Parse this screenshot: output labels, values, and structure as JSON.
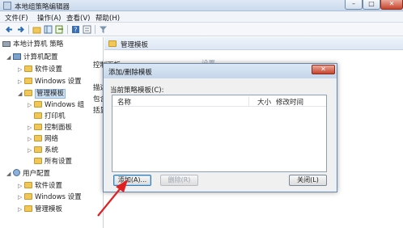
{
  "window": {
    "title": "本地组策略编辑器",
    "min_glyph": "–",
    "max_glyph": "□",
    "close_glyph": "✕"
  },
  "menu": [
    "文件(F)",
    "操作(A)",
    "查看(V)",
    "帮助(H)"
  ],
  "toolbar_icons": [
    "back-arrow-icon",
    "forward-arrow-icon",
    "up-folder-icon",
    "show-hide-tree-icon",
    "export-icon",
    "help-icon",
    "properties-icon",
    "filter-icon"
  ],
  "tree": {
    "root": "本地计算机 策略",
    "computer_config": "计算机配置",
    "c_software": "软件设置",
    "c_windows": "Windows 设置",
    "c_admin": "管理模板",
    "c_admin_windows": "Windows 组",
    "c_printer": "打印机",
    "c_control_panel": "控制面板",
    "c_network": "网络",
    "c_system": "系统",
    "c_all_settings": "所有设置",
    "user_config": "用户配置",
    "u_software": "软件设置",
    "u_windows": "Windows 设置",
    "u_admin": "管理模板",
    "expanded": "◢",
    "collapsed": "▷"
  },
  "right_pane": {
    "header": "管理模板",
    "heading": "控制面板",
    "settings_col": "设置",
    "desc_label": "描述",
    "include_label": "包含",
    "extra_label": "括显"
  },
  "dialog": {
    "title": "添加/删除模板",
    "close_glyph": "✕",
    "list_label": "当前策略模板(C):",
    "columns": {
      "name": "名称",
      "size": "大小",
      "modified": "修改时间"
    },
    "buttons": {
      "add": "添加(A)...",
      "remove": "删除(R)",
      "close": "关闭(L)"
    }
  },
  "colors": {
    "annotation_arrow": "#e02020",
    "accent": "#3c7fb1"
  }
}
